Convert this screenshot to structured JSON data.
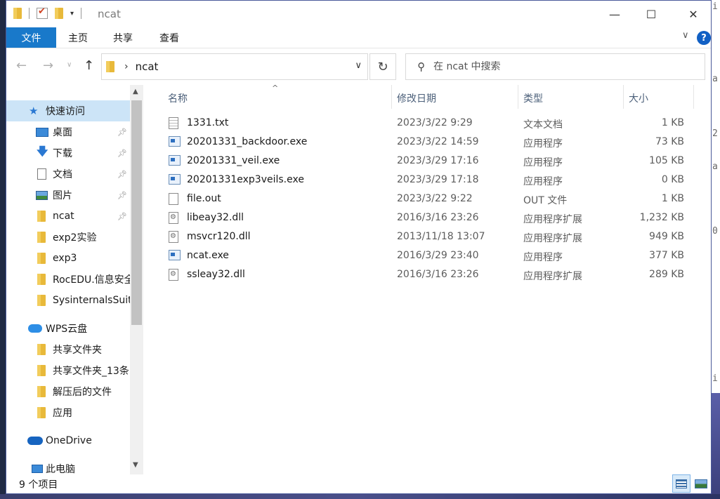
{
  "window": {
    "title": "ncat",
    "controls": {
      "minimize": "—",
      "maximize": "☐",
      "close": "✕"
    }
  },
  "ribbon": {
    "tabs": [
      "文件",
      "主页",
      "共享",
      "查看"
    ],
    "help": "?"
  },
  "address": {
    "path": "ncat",
    "search_placeholder": "在 ncat 中搜索"
  },
  "nav": {
    "items": [
      {
        "label": "快速访问",
        "icon": "star-icon"
      },
      {
        "label": "桌面",
        "icon": "desktop-icon",
        "pinned": true
      },
      {
        "label": "下载",
        "icon": "download-icon",
        "pinned": true
      },
      {
        "label": "文档",
        "icon": "document-icon",
        "pinned": true
      },
      {
        "label": "图片",
        "icon": "pictures-icon",
        "pinned": true
      },
      {
        "label": "ncat",
        "icon": "folder-icon",
        "pinned": true
      },
      {
        "label": "exp2实验",
        "icon": "folder-icon"
      },
      {
        "label": "exp3",
        "icon": "folder-icon"
      },
      {
        "label": "RocEDU.信息安全",
        "icon": "folder-icon"
      },
      {
        "label": "SysinternalsSuite",
        "icon": "folder-icon"
      },
      {
        "label": "WPS云盘",
        "icon": "cloud-icon"
      },
      {
        "label": "共享文件夹",
        "icon": "shared-folder-icon"
      },
      {
        "label": "共享文件夹_13条",
        "icon": "shared-folder-icon"
      },
      {
        "label": "解压后的文件",
        "icon": "folder-icon"
      },
      {
        "label": "应用",
        "icon": "folder-icon"
      },
      {
        "label": "OneDrive",
        "icon": "onedrive-icon"
      },
      {
        "label": "此电脑",
        "icon": "computer-icon"
      }
    ]
  },
  "columns": {
    "name": "名称",
    "date": "修改日期",
    "type": "类型",
    "size": "大小"
  },
  "files": [
    {
      "name": "1331.txt",
      "date": "2023/3/22 9:29",
      "type": "文本文档",
      "size": "1 KB",
      "icon": "text-file-icon"
    },
    {
      "name": "20201331_backdoor.exe",
      "date": "2023/3/22 14:59",
      "type": "应用程序",
      "size": "73 KB",
      "icon": "exe-file-icon"
    },
    {
      "name": "20201331_veil.exe",
      "date": "2023/3/29 17:16",
      "type": "应用程序",
      "size": "105 KB",
      "icon": "exe-file-icon"
    },
    {
      "name": "20201331exp3veils.exe",
      "date": "2023/3/29 17:18",
      "type": "应用程序",
      "size": "0 KB",
      "icon": "exe-file-icon"
    },
    {
      "name": "file.out",
      "date": "2023/3/22 9:22",
      "type": "OUT 文件",
      "size": "1 KB",
      "icon": "blank-file-icon"
    },
    {
      "name": "libeay32.dll",
      "date": "2016/3/16 23:26",
      "type": "应用程序扩展",
      "size": "1,232 KB",
      "icon": "dll-file-icon"
    },
    {
      "name": "msvcr120.dll",
      "date": "2013/11/18 13:07",
      "type": "应用程序扩展",
      "size": "949 KB",
      "icon": "dll-file-icon"
    },
    {
      "name": "ncat.exe",
      "date": "2016/3/29 23:40",
      "type": "应用程序",
      "size": "377 KB",
      "icon": "exe-file-icon"
    },
    {
      "name": "ssleay32.dll",
      "date": "2016/3/16 23:26",
      "type": "应用程序扩展",
      "size": "289 KB",
      "icon": "dll-file-icon"
    }
  ],
  "status": {
    "item_count": "9 个项目"
  },
  "background_fragments": [
    "i",
    "a",
    "2",
    "a",
    "0",
    "i"
  ]
}
